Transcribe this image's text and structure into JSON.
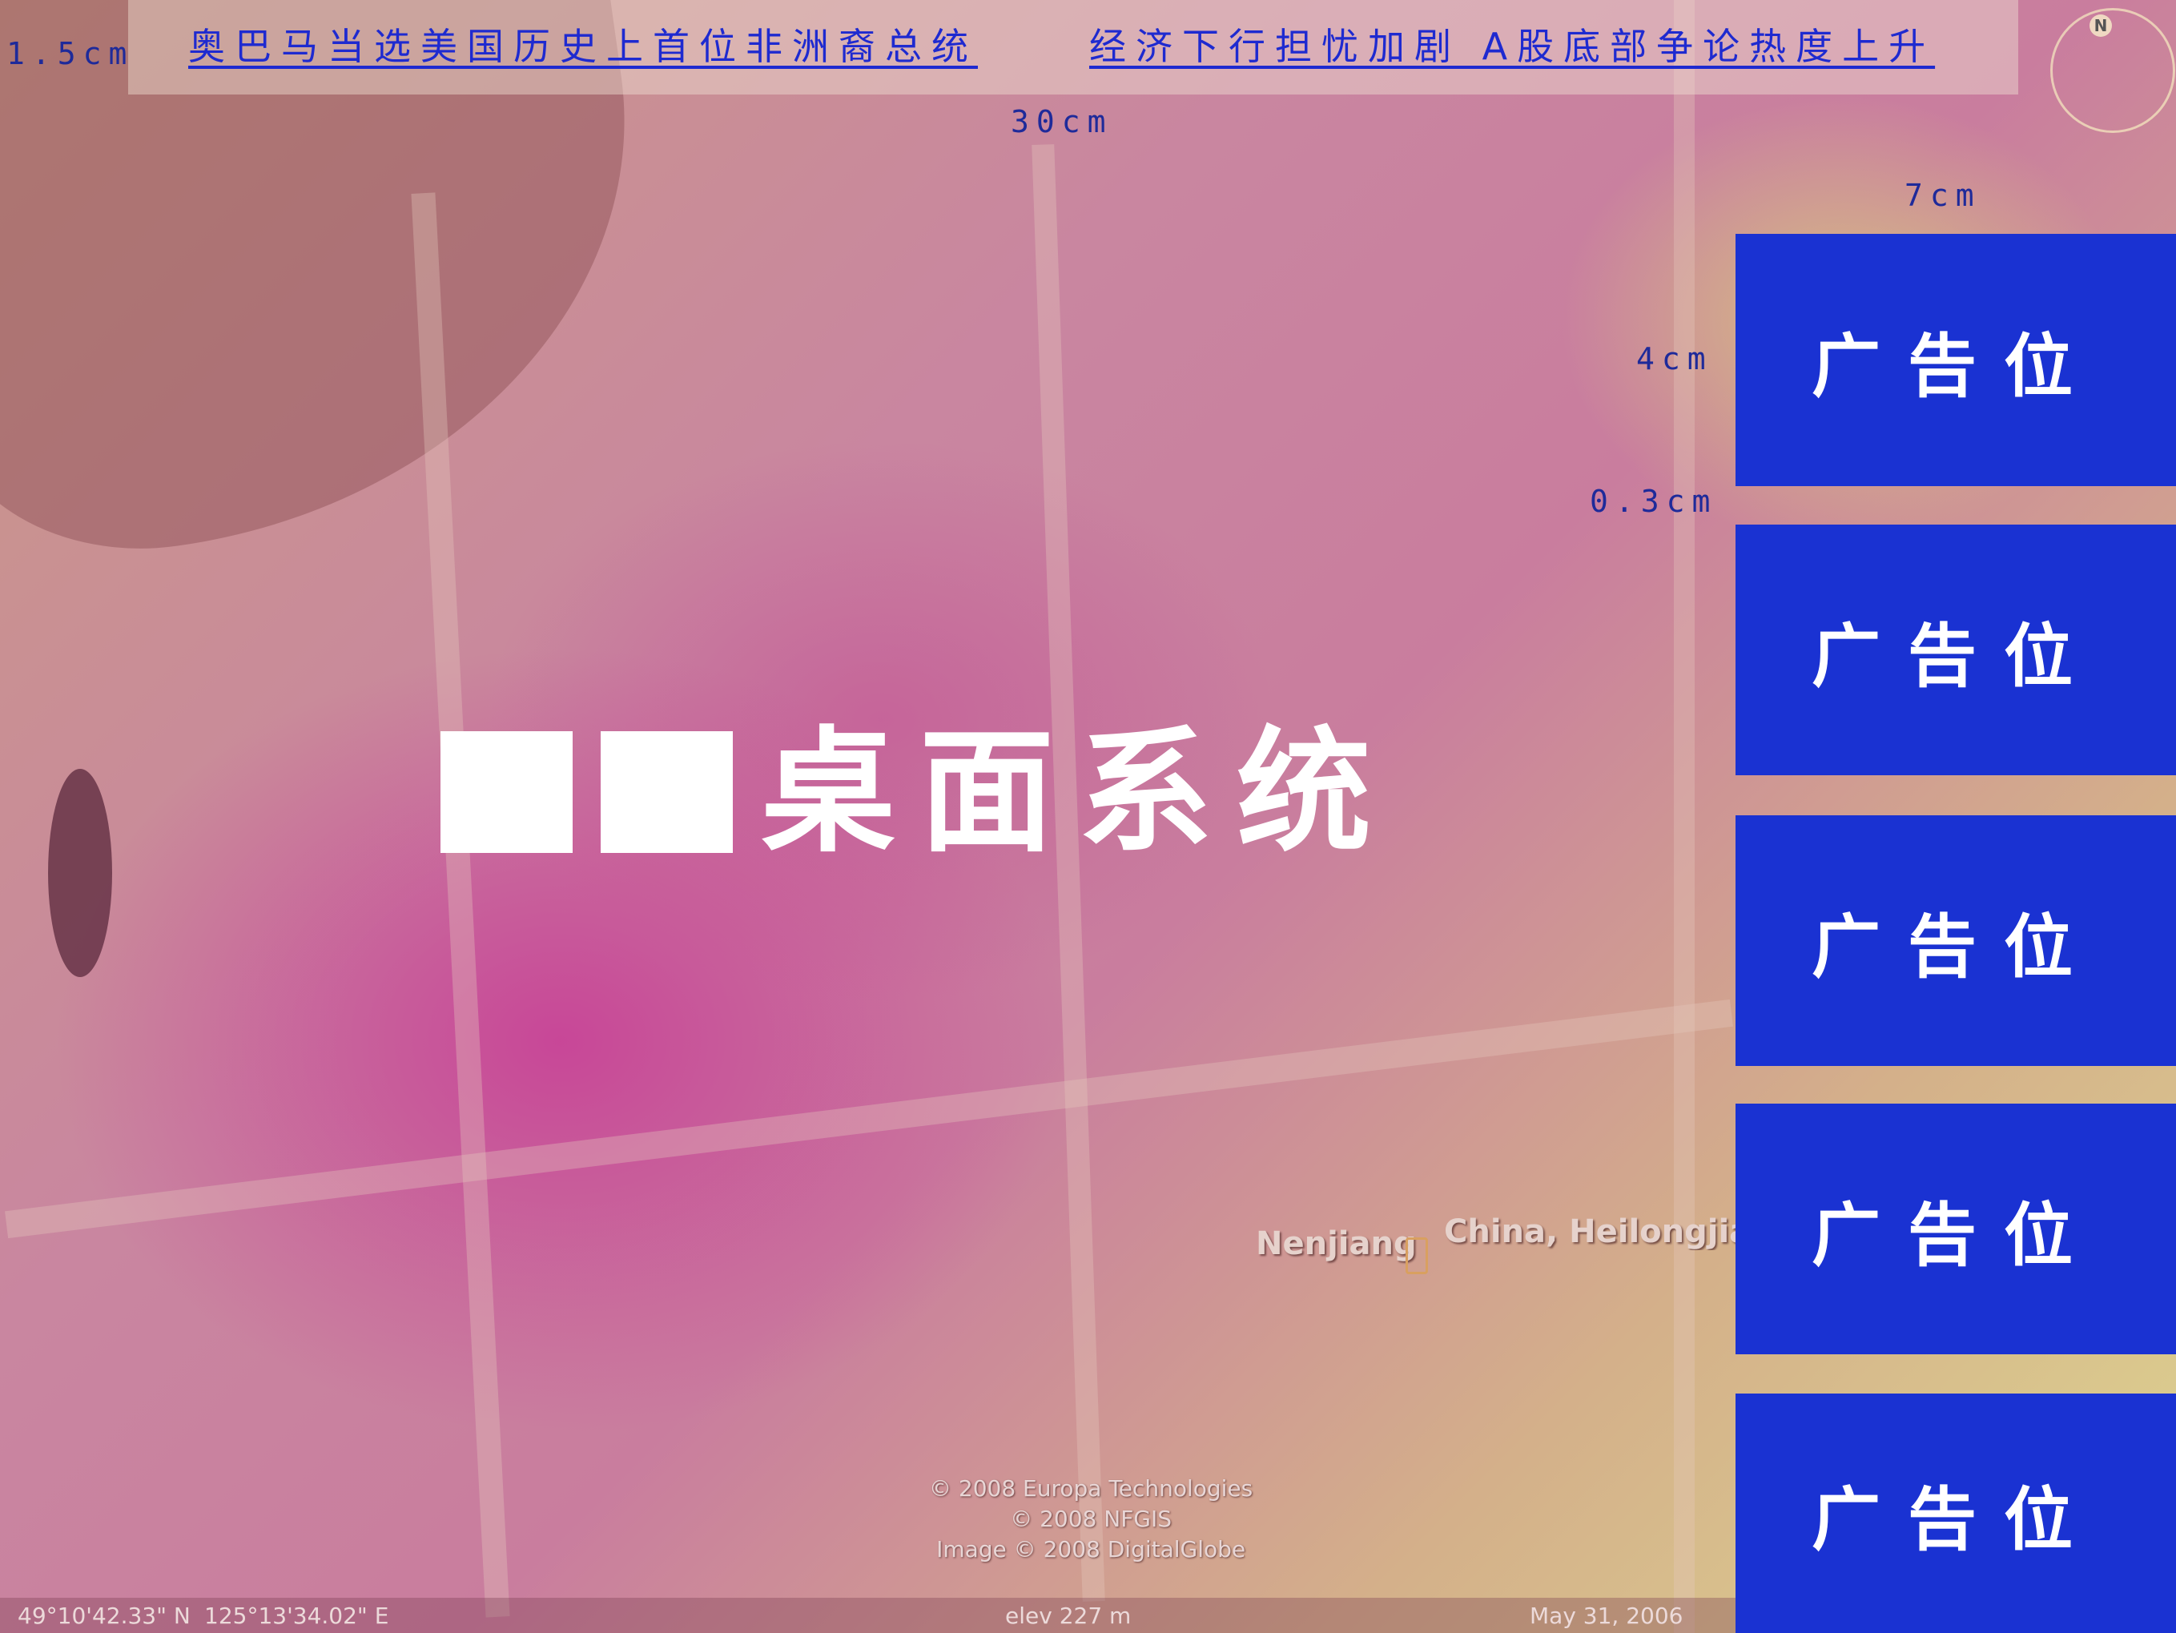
{
  "scale_labels": {
    "top_height": "1.5cm",
    "banner_width": "30cm",
    "ad_width": "7cm",
    "ad_height": "4cm",
    "ad_gap": "0.3cm"
  },
  "news": [
    {
      "text": "奥巴马当选美国历史上首位非洲裔总统"
    },
    {
      "text": "经济下行担忧加剧 A股底部争论热度上升"
    }
  ],
  "main_title": {
    "suffix": "桌面系统"
  },
  "ads": [
    {
      "label": "广告位"
    },
    {
      "label": "广告位"
    },
    {
      "label": "广告位"
    },
    {
      "label": "广告位"
    },
    {
      "label": "广告位"
    }
  ],
  "map": {
    "place_label": "Nenjiang",
    "region_label": "China, Heilongjiang",
    "copyright": [
      "© 2008 Europa Technologies",
      "© 2008 NFGIS",
      "Image © 2008 DigitalGlobe"
    ],
    "latitude": "49°10'42.33\" N",
    "longitude": "125°13'34.02\" E",
    "elevation": "elev  227 m",
    "date": "May 31, 2006",
    "compass_label": "N"
  },
  "colors": {
    "ad_background": "#1a32d2",
    "news_link": "#1e2ad0",
    "scale_text": "#1e2a9a"
  }
}
